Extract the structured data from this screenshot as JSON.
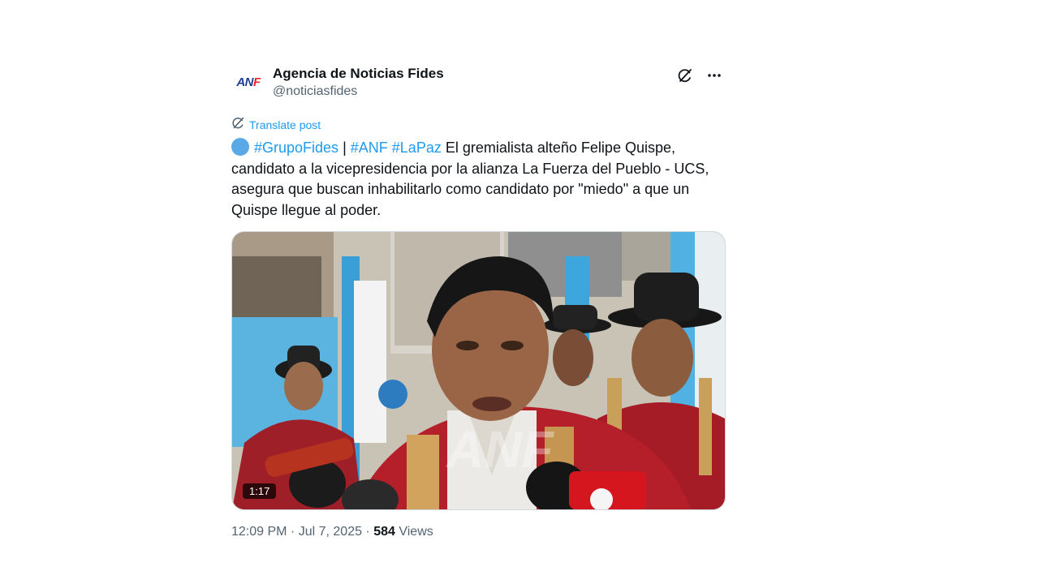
{
  "author": {
    "display_name": "Agencia de Noticias Fides",
    "handle": "@noticiasfides",
    "avatar_text_main": "AN",
    "avatar_text_accent": "F",
    "avatar_icon": "anf-logo"
  },
  "header_icons": [
    "grok-icon",
    "more-options-icon"
  ],
  "translate": {
    "label": "Translate post",
    "icon": "translate-icon"
  },
  "post": {
    "hashtag_1": "#GrupoFides",
    "separator": " | ",
    "hashtag_2": "#ANF",
    "hashtag_3": "#LaPaz",
    "body": " El gremialista alteño Felipe Quispe, candidato a la vicepresidencia por la alianza La Fuerza del Pueblo - UCS, asegura que buscan inhabilitarlo como candidato por \"miedo\" a que un Quispe llegue al poder.",
    "dot_color": "#5aa9e6"
  },
  "media": {
    "duration": "1:17",
    "watermark": "ANF"
  },
  "meta": {
    "time": "12:09 PM",
    "date_sep": " · ",
    "date": "Jul 7, 2025",
    "views_sep": " · ",
    "views_count": "584",
    "views_label": " Views"
  },
  "colors": {
    "link": "#1d9bf0",
    "secondary": "#536471",
    "text": "#0f1419"
  }
}
